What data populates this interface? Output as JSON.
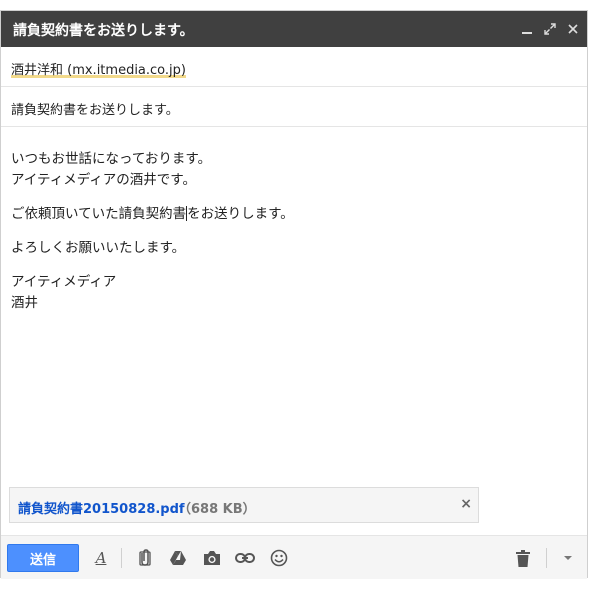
{
  "window": {
    "title": "請負契約書をお送りします。"
  },
  "recipients": {
    "to": "酒井洋和 (mx.itmedia.co.jp)"
  },
  "subject": {
    "value": "請負契約書をお送りします。"
  },
  "body": {
    "p1_line1": "いつもお世話になっております。",
    "p1_line2": "アイティメディアの酒井です。",
    "p2_before_caret": "ご依頼頂いていた請負契約書",
    "p2_after_caret": "をお送りします。",
    "p3": "よろしくお願いいたします。",
    "sig_line1": "アイティメディア",
    "sig_line2": "酒井"
  },
  "attachment": {
    "filename": "請負契約書20150828.pdf",
    "size": "（688 KB）",
    "remove_glyph": "×"
  },
  "toolbar": {
    "send_label": "送信",
    "format_glyph": "A"
  },
  "colors": {
    "titlebar": "#404040",
    "send": "#4d90fe",
    "link": "#1155cc"
  },
  "icons": [
    "minimize-icon",
    "expand-icon",
    "close-icon",
    "format-text-icon",
    "attach-icon",
    "drive-icon",
    "camera-icon",
    "link-icon",
    "emoji-icon",
    "trash-icon",
    "more-options-icon"
  ]
}
